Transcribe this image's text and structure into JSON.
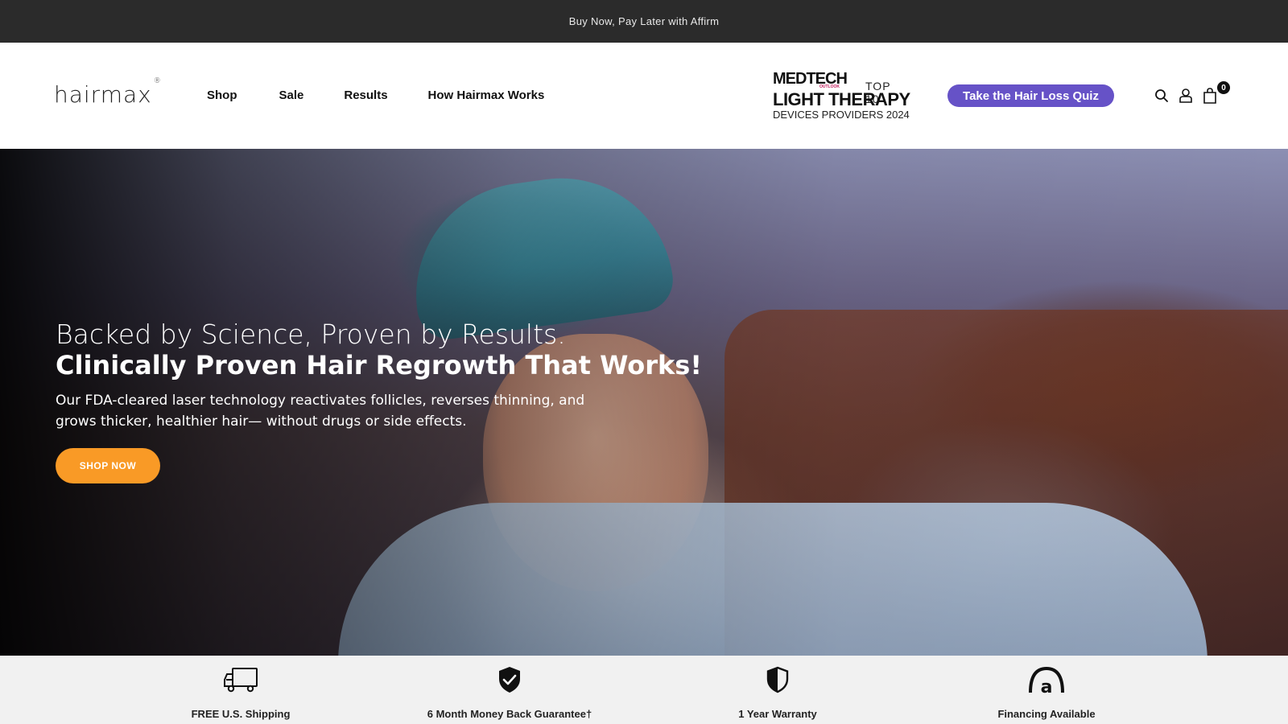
{
  "announcement": "Buy Now, Pay Later with Affirm",
  "logo": {
    "text": "hairmax",
    "mark": "®"
  },
  "nav": [
    "Shop",
    "Sale",
    "Results",
    "How Hairmax Works"
  ],
  "award": {
    "brand": "MEDTECH",
    "brand_sub": "OUTLOOK",
    "rank": "TOP 10",
    "title": "LIGHT THERAPY",
    "subtitle": "DEVICES PROVIDERS 2024"
  },
  "quiz_button": "Take the Hair Loss Quiz",
  "header_icons": [
    "search-icon",
    "account-icon",
    "cart-icon"
  ],
  "cart_count": "0",
  "hero": {
    "line1": "Backed by Science, Proven by Results.",
    "line2": "Clinically Proven Hair Regrowth That Works!",
    "sub": "Our FDA-cleared laser technology reactivates follicles, reverses thinning, and grows thicker, healthier hair— without drugs or side effects.",
    "cta": "SHOP NOW"
  },
  "features": [
    {
      "icon": "truck-icon",
      "label": "FREE U.S. Shipping"
    },
    {
      "icon": "shield-check-icon",
      "label": "6 Month Money Back Guarantee†"
    },
    {
      "icon": "shield-half-icon",
      "label": "1 Year Warranty"
    },
    {
      "icon": "affirm-icon",
      "label": "Financing Available"
    }
  ],
  "colors": {
    "quiz": "#6652c7",
    "cta": "#f99a26",
    "topbar": "#2b2b2b"
  }
}
